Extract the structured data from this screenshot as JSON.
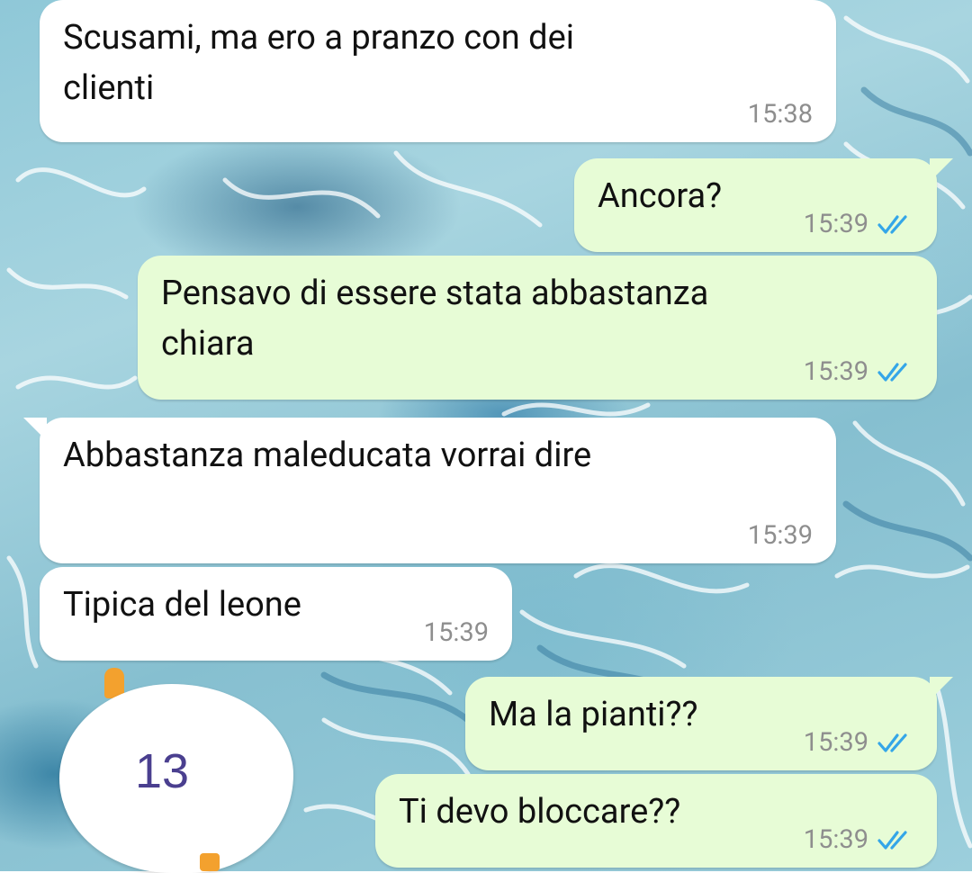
{
  "messages": [
    {
      "direction": "in",
      "text": "Scusami, ma ero a pranzo con dei\nclienti",
      "time": "15:38"
    },
    {
      "direction": "out",
      "text": "Ancora?",
      "time": "15:39",
      "status": "read"
    },
    {
      "direction": "out",
      "text": "Pensavo di essere stata abbastanza\nchiara",
      "time": "15:39",
      "status": "read"
    },
    {
      "direction": "in",
      "text": "Abbastanza maleducata vorrai dire",
      "time": "15:39"
    },
    {
      "direction": "in",
      "text": "Tipica del leone",
      "time": "15:39"
    },
    {
      "direction": "out",
      "text": "Ma la pianti??",
      "time": "15:39",
      "status": "read"
    },
    {
      "direction": "out",
      "text": "Ti devo bloccare??",
      "time": "15:39",
      "status": "read"
    }
  ],
  "overlay": {
    "count": "13"
  },
  "colors": {
    "incoming_bubble": "#ffffff",
    "outgoing_bubble": "#e7fcd6",
    "read_tick": "#34a6e8",
    "timestamp": "#8e8e8e",
    "overlay_number": "#4a3f8f",
    "accent_orange": "#f3a12e"
  },
  "icons": {
    "read_receipt": "double-check-icon"
  }
}
